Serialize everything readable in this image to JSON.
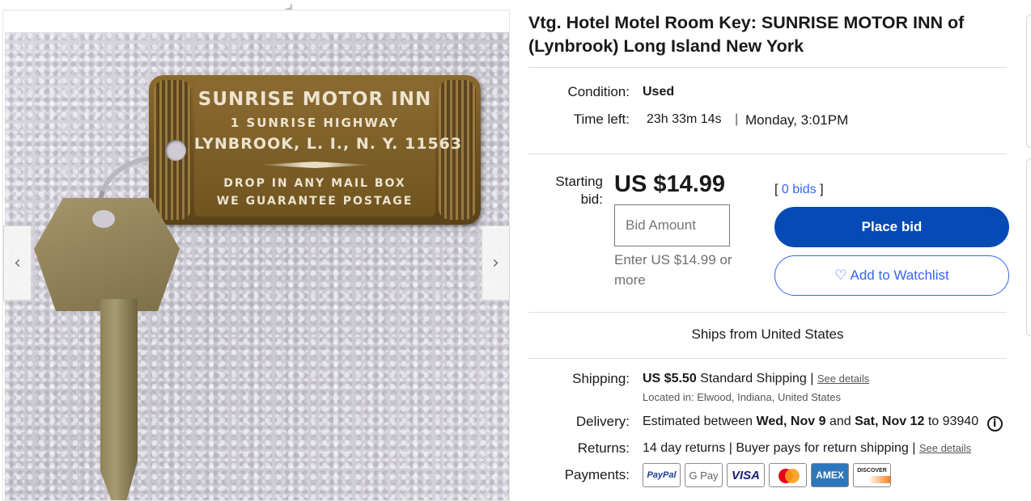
{
  "gallery": {
    "tag_lines": [
      "SUNRISE MOTOR INN",
      "1 SUNRISE HIGHWAY",
      "LYNBROOK, L. I., N. Y. 11563",
      "DROP IN ANY MAIL BOX",
      "WE GUARANTEE POSTAGE"
    ],
    "prev_icon": "‹",
    "next_icon": "›"
  },
  "item": {
    "title": "Vtg. Hotel Motel Room Key: SUNRISE MOTOR INN of (Lynbrook) Long Island New York",
    "condition_label": "Condition:",
    "condition_value": "Used",
    "time_left_label": "Time left:",
    "time_left_value": "23h 33m 14s",
    "time_left_sep": "|",
    "end_time": "Monday, 3:01PM"
  },
  "bidding": {
    "starting_bid_label": "Starting bid:",
    "price": "US $14.99",
    "bids_open": "[",
    "bids_link": "0 bids",
    "bids_close": "]",
    "bid_placeholder": "Bid Amount",
    "bid_hint": "Enter US $14.99 or more",
    "place_bid_label": "Place bid",
    "watchlist_label": "Add to Watchlist",
    "watchlist_icon": "♡"
  },
  "shipping": {
    "ships_from": "Ships from United States",
    "shipping_label": "Shipping:",
    "shipping_cost": "US $5.50",
    "shipping_method": "Standard Shipping |",
    "see_details": "See details",
    "located_in": "Located in: Elwood, Indiana, United States",
    "delivery_label": "Delivery:",
    "delivery_prefix": "Estimated between",
    "delivery_start": "Wed, Nov 9",
    "delivery_and": "and",
    "delivery_end": "Sat, Nov 12",
    "delivery_to": "to 93940",
    "info_icon": "i",
    "returns_label": "Returns:",
    "returns_text": "14 day returns | Buyer pays for return shipping |",
    "returns_see_details": "See details",
    "payments_label": "Payments:"
  },
  "payments": {
    "paypal": "PayPal",
    "gpay": "G Pay",
    "visa": "VISA",
    "amex": "AMEX",
    "discover": "DISCOVER"
  }
}
